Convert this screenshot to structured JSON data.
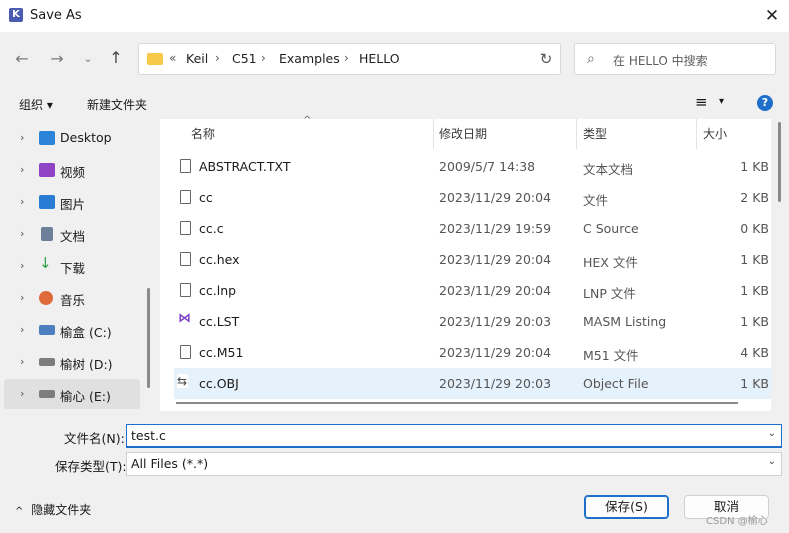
{
  "window": {
    "title": "Save As",
    "close_icon": "close-icon"
  },
  "address": {
    "overflow": "«",
    "crumbs": [
      "Keil",
      "C51",
      "Examples",
      "HELLO"
    ],
    "separator": "›"
  },
  "search": {
    "placeholder": "在 HELLO 中搜索"
  },
  "toolbar": {
    "organize": "组织 ▾",
    "new_folder": "新建文件夹",
    "view_icon": "≡",
    "view_drop": "▾",
    "help": "?"
  },
  "nav": {
    "items": [
      {
        "label": "Desktop",
        "icon": "desktop-icon",
        "color": "#2b84d8"
      },
      {
        "label": "视频",
        "icon": "video-icon",
        "color": "#8e44c5"
      },
      {
        "label": "图片",
        "icon": "pictures-icon",
        "color": "#2a7bd4"
      },
      {
        "label": "文档",
        "icon": "documents-icon",
        "color": "#6d7f99"
      },
      {
        "label": "下载",
        "icon": "download-icon",
        "color": "#2ea04a"
      },
      {
        "label": "音乐",
        "icon": "music-icon",
        "color": "#e06b3a"
      },
      {
        "label": "榆盒 (C:)",
        "icon": "drive-c-icon",
        "color": "#4b7fbf"
      },
      {
        "label": "榆树 (D:)",
        "icon": "drive-d-icon",
        "color": "#7d7d7d"
      },
      {
        "label": "榆心 (E:)",
        "icon": "drive-e-icon",
        "color": "#7d7d7d"
      }
    ]
  },
  "files": {
    "headers": {
      "name": "名称",
      "date": "修改日期",
      "type": "类型",
      "size": "大小"
    },
    "rows": [
      {
        "name": "ABSTRACT.TXT",
        "date": "2009/5/7 14:38",
        "type": "文本文档",
        "size": "1 KB"
      },
      {
        "name": "cc",
        "date": "2023/11/29 20:04",
        "type": "文件",
        "size": "2 KB"
      },
      {
        "name": "cc.c",
        "date": "2023/11/29 19:59",
        "type": "C Source",
        "size": "0 KB"
      },
      {
        "name": "cc.hex",
        "date": "2023/11/29 20:04",
        "type": "HEX 文件",
        "size": "1 KB"
      },
      {
        "name": "cc.lnp",
        "date": "2023/11/29 20:04",
        "type": "LNP 文件",
        "size": "1 KB"
      },
      {
        "name": "cc.LST",
        "date": "2023/11/29 20:03",
        "type": "MASM Listing",
        "size": "1 KB"
      },
      {
        "name": "cc.M51",
        "date": "2023/11/29 20:04",
        "type": "M51 文件",
        "size": "4 KB"
      },
      {
        "name": "cc.OBJ",
        "date": "2023/11/29 20:03",
        "type": "Object File",
        "size": "1 KB"
      }
    ]
  },
  "form": {
    "filename_label": "文件名(N):",
    "filename_value": "test.c",
    "filetype_label": "保存类型(T):",
    "filetype_value": "All Files (*.*)"
  },
  "footer": {
    "hide_folders": "隐藏文件夹",
    "save": "保存(S)",
    "cancel": "取消",
    "watermark": "CSDN @榆心"
  }
}
